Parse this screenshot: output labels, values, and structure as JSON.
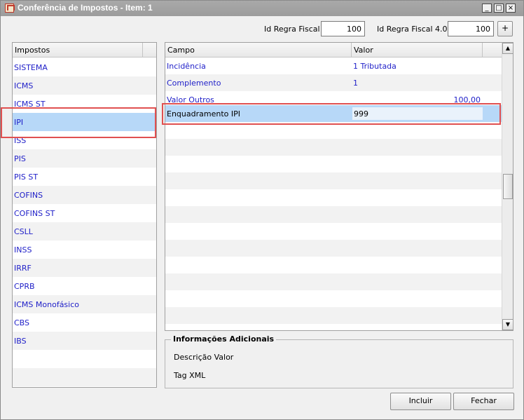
{
  "window": {
    "title": "Conferência de Impostos - Item: 1",
    "minimize_glyph": "_",
    "maximize_glyph": "□",
    "close_glyph": "×"
  },
  "fields": {
    "id_regra_fiscal_label": "Id Regra Fiscal",
    "id_regra_fiscal_value": "100",
    "id_regra_fiscal_40_label": "Id Regra Fiscal 4.0",
    "id_regra_fiscal_40_value": "100",
    "plus_label": "+"
  },
  "taxlist": {
    "header": "Impostos",
    "items": [
      {
        "label": "SISTEMA"
      },
      {
        "label": "ICMS"
      },
      {
        "label": "ICMS ST"
      },
      {
        "label": "IPI"
      },
      {
        "label": "ISS"
      },
      {
        "label": "PIS"
      },
      {
        "label": "PIS ST"
      },
      {
        "label": "COFINS"
      },
      {
        "label": "COFINS ST"
      },
      {
        "label": "CSLL"
      },
      {
        "label": "INSS"
      },
      {
        "label": "IRRF"
      },
      {
        "label": "CPRB"
      },
      {
        "label": "ICMS Monofásico"
      },
      {
        "label": "CBS"
      },
      {
        "label": "IBS"
      }
    ],
    "selected": "IPI"
  },
  "grid": {
    "columns": [
      "Campo",
      "Valor"
    ],
    "rows": [
      {
        "campo": "Incidência",
        "valor": "1 Tributada"
      },
      {
        "campo": "Complemento",
        "valor": "1"
      },
      {
        "campo": "Valor Outros",
        "valor": "100,00"
      },
      {
        "campo": "Enquadramento IPI",
        "valor": "999"
      }
    ]
  },
  "info": {
    "title": "Informações Adicionais",
    "descricao_label": "Descrição Valor",
    "tag_label": "Tag XML"
  },
  "buttons": {
    "incluir": "Incluir",
    "fechar": "Fechar"
  },
  "colors": {
    "selection": "#b7d8f8",
    "link_text": "#1e1ec8",
    "highlight_border": "#e05050"
  }
}
